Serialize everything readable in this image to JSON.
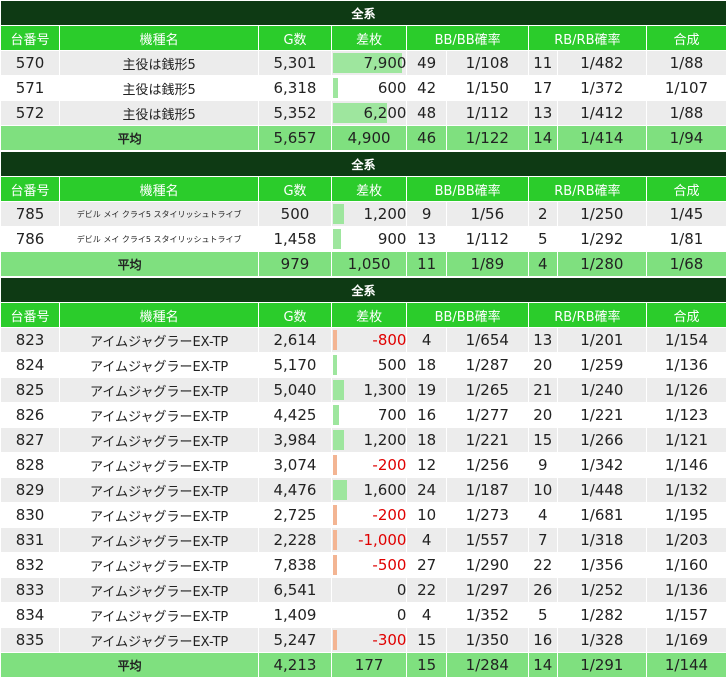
{
  "columns": [
    "台番号",
    "機種名",
    "G数",
    "差枚",
    "BB/BB確率",
    "",
    "RB/RB確率",
    "",
    "合成"
  ],
  "colors": {
    "banner": "#0e3a14",
    "header": "#2bcc2b",
    "average": "#7fe07f",
    "plus_bar": "#9ee69e",
    "minus_bar": "#f3b593",
    "minus_text": "#e00000"
  },
  "sections": [
    {
      "title": "全系",
      "small_name": false,
      "rows": [
        {
          "no": "570",
          "machine": "主役は銭形5",
          "games": "5,301",
          "diff": "7,900",
          "diff_value": 7900,
          "bb": "49",
          "bb_rate": "1/108",
          "rb": "11",
          "rb_rate": "1/482",
          "total": "1/88"
        },
        {
          "no": "571",
          "machine": "主役は銭形5",
          "games": "6,318",
          "diff": "600",
          "diff_value": 600,
          "bb": "42",
          "bb_rate": "1/150",
          "rb": "17",
          "rb_rate": "1/372",
          "total": "1/107"
        },
        {
          "no": "572",
          "machine": "主役は銭形5",
          "games": "5,352",
          "diff": "6,200",
          "diff_value": 6200,
          "bb": "48",
          "bb_rate": "1/112",
          "rb": "13",
          "rb_rate": "1/412",
          "total": "1/88"
        }
      ],
      "average": {
        "label": "平均",
        "games": "5,657",
        "diff": "4,900",
        "bb": "46",
        "bb_rate": "1/122",
        "rb": "14",
        "rb_rate": "1/414",
        "total": "1/94"
      }
    },
    {
      "title": "全系",
      "small_name": true,
      "rows": [
        {
          "no": "785",
          "machine": "デビル メイ クライ5 スタイリッシュトライブ",
          "games": "500",
          "diff": "1,200",
          "diff_value": 1200,
          "bb": "9",
          "bb_rate": "1/56",
          "rb": "2",
          "rb_rate": "1/250",
          "total": "1/45"
        },
        {
          "no": "786",
          "machine": "デビル メイ クライ5 スタイリッシュトライブ",
          "games": "1,458",
          "diff": "900",
          "diff_value": 900,
          "bb": "13",
          "bb_rate": "1/112",
          "rb": "5",
          "rb_rate": "1/292",
          "total": "1/81"
        }
      ],
      "average": {
        "label": "平均",
        "games": "979",
        "diff": "1,050",
        "bb": "11",
        "bb_rate": "1/89",
        "rb": "4",
        "rb_rate": "1/280",
        "total": "1/68"
      }
    },
    {
      "title": "全系",
      "small_name": false,
      "rows": [
        {
          "no": "823",
          "machine": "アイムジャグラーEX-TP",
          "games": "2,614",
          "diff": "-800",
          "diff_value": -800,
          "bb": "4",
          "bb_rate": "1/654",
          "rb": "13",
          "rb_rate": "1/201",
          "total": "1/154"
        },
        {
          "no": "824",
          "machine": "アイムジャグラーEX-TP",
          "games": "5,170",
          "diff": "500",
          "diff_value": 500,
          "bb": "18",
          "bb_rate": "1/287",
          "rb": "20",
          "rb_rate": "1/259",
          "total": "1/136"
        },
        {
          "no": "825",
          "machine": "アイムジャグラーEX-TP",
          "games": "5,040",
          "diff": "1,300",
          "diff_value": 1300,
          "bb": "19",
          "bb_rate": "1/265",
          "rb": "21",
          "rb_rate": "1/240",
          "total": "1/126"
        },
        {
          "no": "826",
          "machine": "アイムジャグラーEX-TP",
          "games": "4,425",
          "diff": "700",
          "diff_value": 700,
          "bb": "16",
          "bb_rate": "1/277",
          "rb": "20",
          "rb_rate": "1/221",
          "total": "1/123"
        },
        {
          "no": "827",
          "machine": "アイムジャグラーEX-TP",
          "games": "3,984",
          "diff": "1,200",
          "diff_value": 1200,
          "bb": "18",
          "bb_rate": "1/221",
          "rb": "15",
          "rb_rate": "1/266",
          "total": "1/121"
        },
        {
          "no": "828",
          "machine": "アイムジャグラーEX-TP",
          "games": "3,074",
          "diff": "-200",
          "diff_value": -200,
          "bb": "12",
          "bb_rate": "1/256",
          "rb": "9",
          "rb_rate": "1/342",
          "total": "1/146"
        },
        {
          "no": "829",
          "machine": "アイムジャグラーEX-TP",
          "games": "4,476",
          "diff": "1,600",
          "diff_value": 1600,
          "bb": "24",
          "bb_rate": "1/187",
          "rb": "10",
          "rb_rate": "1/448",
          "total": "1/132"
        },
        {
          "no": "830",
          "machine": "アイムジャグラーEX-TP",
          "games": "2,725",
          "diff": "-200",
          "diff_value": -200,
          "bb": "10",
          "bb_rate": "1/273",
          "rb": "4",
          "rb_rate": "1/681",
          "total": "1/195"
        },
        {
          "no": "831",
          "machine": "アイムジャグラーEX-TP",
          "games": "2,228",
          "diff": "-1,000",
          "diff_value": -1000,
          "bb": "4",
          "bb_rate": "1/557",
          "rb": "7",
          "rb_rate": "1/318",
          "total": "1/203"
        },
        {
          "no": "832",
          "machine": "アイムジャグラーEX-TP",
          "games": "7,838",
          "diff": "-500",
          "diff_value": -500,
          "bb": "27",
          "bb_rate": "1/290",
          "rb": "22",
          "rb_rate": "1/356",
          "total": "1/160"
        },
        {
          "no": "833",
          "machine": "アイムジャグラーEX-TP",
          "games": "6,541",
          "diff": "0",
          "diff_value": 0,
          "bb": "22",
          "bb_rate": "1/297",
          "rb": "26",
          "rb_rate": "1/252",
          "total": "1/136"
        },
        {
          "no": "834",
          "machine": "アイムジャグラーEX-TP",
          "games": "1,409",
          "diff": "0",
          "diff_value": 0,
          "bb": "4",
          "bb_rate": "1/352",
          "rb": "5",
          "rb_rate": "1/282",
          "total": "1/157"
        },
        {
          "no": "835",
          "machine": "アイムジャグラーEX-TP",
          "games": "5,247",
          "diff": "-300",
          "diff_value": -300,
          "bb": "15",
          "bb_rate": "1/350",
          "rb": "16",
          "rb_rate": "1/328",
          "total": "1/169"
        }
      ],
      "average": {
        "label": "平均",
        "games": "4,213",
        "diff": "177",
        "bb": "15",
        "bb_rate": "1/284",
        "rb": "14",
        "rb_rate": "1/291",
        "total": "1/144"
      }
    }
  ]
}
